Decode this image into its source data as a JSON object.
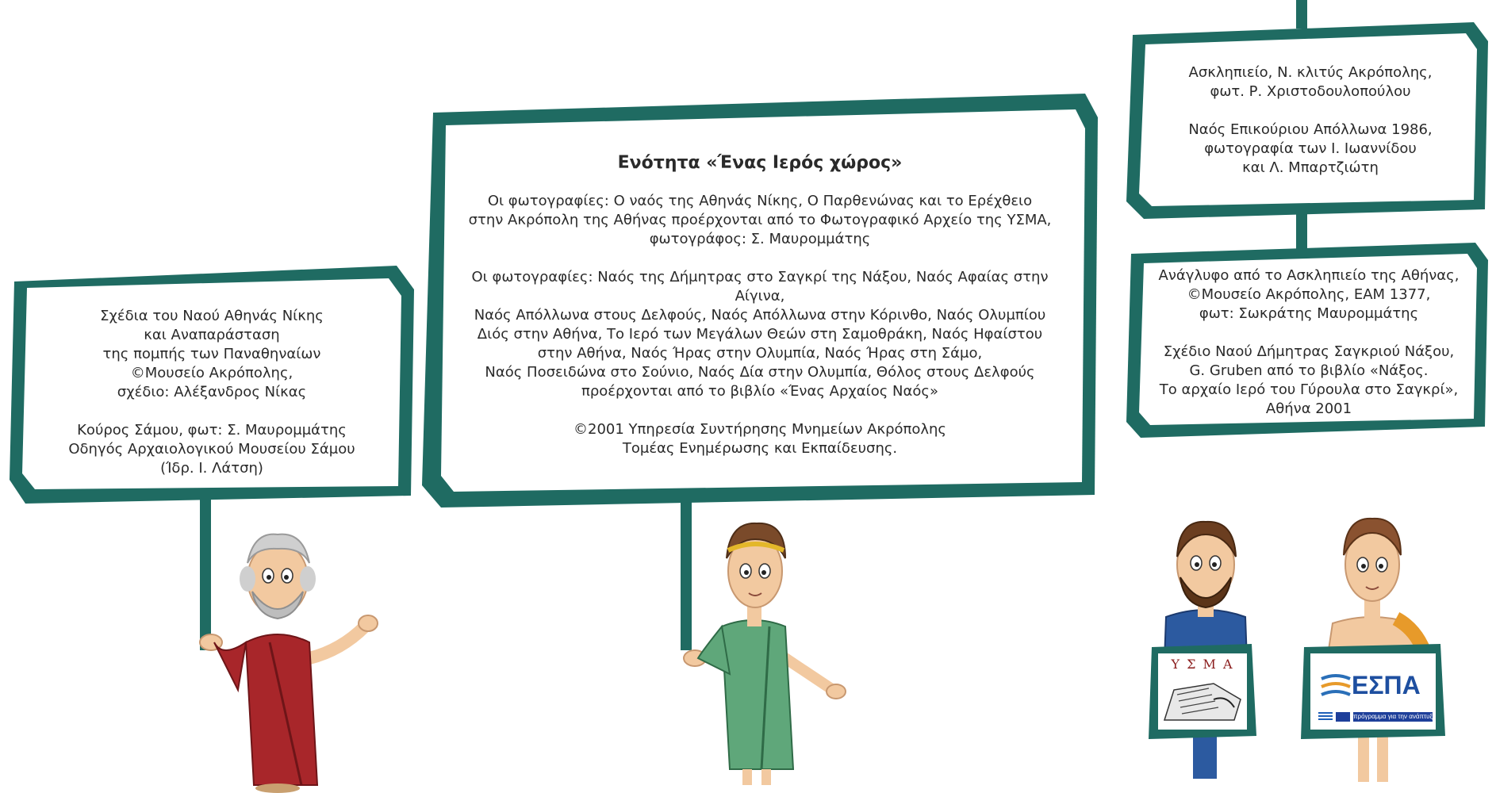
{
  "left_sign": {
    "lines": [
      "Σχέδια του Ναού Αθηνάς Νίκης",
      "και Αναπαράσταση",
      "της πομπής των Παναθηναίων",
      "©Μουσείο Ακρόπολης,",
      "σχέδιο: Αλέξανδρος Νίκας",
      "",
      "Κούρος Σάμου, φωτ: Σ. Μαυρομμάτης",
      "Οδηγός Αρχαιολογικού Μουσείου Σάμου",
      "(Ίδρ. Ι. Λάτση)"
    ]
  },
  "center_sign": {
    "title": "Ενότητα «Ένας Ιερός χώρος»",
    "lines": [
      "Οι φωτογραφίες: Ο ναός της Αθηνάς Νίκης, Ο Παρθενώνας και το Ερέχθειο",
      "στην Ακρόπολη της Αθήνας προέρχονται από το Φωτογραφικό Αρχείο της ΥΣΜΑ,",
      "φωτογράφος: Σ. Μαυρομμάτης",
      "",
      "Οι φωτογραφίες: Ναός της Δήμητρας στο Σαγκρί της Νάξου, Ναός Αφαίας στην Αίγινα,",
      "Ναός Απόλλωνα στους Δελφούς, Ναός Απόλλωνα στην Κόρινθο, Ναός Ολυμπίου",
      "Διός στην Αθήνα, Το Ιερό των Μεγάλων Θεών στη Σαμοθράκη, Ναός Ηφαίστου",
      "στην Αθήνα, Ναός Ήρας στην Ολυμπία, Ναός Ήρας στη Σάμο,",
      "Ναός Ποσειδώνα στο Σούνιο, Ναός Δία στην Ολυμπία, Θόλος στους Δελφούς",
      "προέρχονται από το βιβλίο «Ένας Αρχαίος Ναός»",
      "",
      "©2001 Υπηρεσία Συντήρησης Μνημείων Ακρόπολης",
      "Τομέας Ενημέρωσης και Εκπαίδευσης."
    ]
  },
  "top_right_sign": {
    "lines": [
      "Ασκληπιείο, Ν. κλιτύς Ακρόπολης,",
      "φωτ. Ρ. Χριστοδουλοπούλου",
      "",
      "Ναός Επικούριου Απόλλωνα 1986,",
      "φωτογραφία των Ι. Ιωαννίδου",
      "και Λ. Μπαρτζιώτη"
    ]
  },
  "bottom_right_sign": {
    "lines": [
      "Ανάγλυφο από το Ασκληπιείο της Αθήνας,",
      "©Μουσείο Ακρόπολης, ΕΑΜ 1377,",
      "φωτ: Σωκράτης Μαυρομμάτης",
      "",
      "Σχέδιο Ναού Δήμητρας Σαγκριού Νάξου,",
      "G. Gruben από το βιβλίο «Νάξος.",
      "Το αρχαίο Ιερό του Γύρουλα στο Σαγκρί»,",
      "Αθήνα 2001"
    ]
  },
  "logos": {
    "ysma": "Υ Σ Μ Α",
    "espa": "ΕΣΠΑ",
    "espa_tagline": "πρόγραμμα για την ανάπτυξη"
  },
  "colors": {
    "frame_dark": "#1f6b62",
    "frame_light": "#2f8a7d",
    "board_fill": "#ffffff"
  }
}
